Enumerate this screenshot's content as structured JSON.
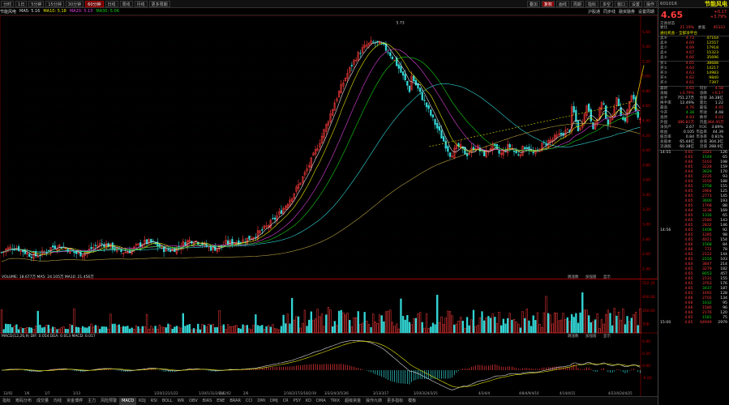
{
  "toolbar": {
    "items": [
      "分时",
      "1日",
      "5分钟",
      "15分钟",
      "30分钟",
      "60分钟",
      "日线",
      "周线",
      "月线",
      "更多周期"
    ],
    "active_index": 5,
    "right_items": [
      "叠加",
      "复权",
      "画线",
      "周期",
      "指标",
      "多空",
      "窗口",
      "设置",
      "操作"
    ],
    "right_active": 1
  },
  "infobar": {
    "name": "节能风电",
    "ma1": "MA5: 5.16",
    "ma2": "MA10: 5.18",
    "ma3": "MA20: 5.13",
    "ma4": "MA30: 5.06",
    "links": [
      "沪股通",
      "同步线",
      "融资融券",
      "设置周期"
    ]
  },
  "main_chart": {
    "peak_label": "5.73",
    "y_ticks": [
      "5.60",
      "5.40",
      "5.20",
      "5.00",
      "4.80",
      "4.60",
      "4.40",
      "4.20",
      "4.00",
      "3.80",
      "3.60",
      "3.40",
      "3.20",
      "3.00",
      "2.80",
      "2.60",
      "2.40"
    ]
  },
  "volume": {
    "header": "VOLUME: 18.677万  MA5: 24.105万  MA10: 21.456万",
    "right_labels": [
      "跳涨数",
      "加强版",
      "显示"
    ],
    "y_ticks": [
      "552.35",
      "400.00",
      "200.00",
      "万手"
    ]
  },
  "macd": {
    "header": "MACD(12,26,9)  DIF: 0.054  DEA: 0.013  MACD: 0.017",
    "right_labels": [
      "跳涨数",
      "加强版",
      "显示"
    ],
    "y_ticks": [
      "0.40",
      "0.20",
      "0.00",
      "-0.20"
    ]
  },
  "x_dates": [
    "12/02",
    "1/6",
    "1/7",
    "1/13",
    "1/20/1/21/1/22",
    "1/30/1/31/2/01/2/02",
    "2/4",
    "2/6",
    "2/16/2/17/2/18/2/19",
    "3/3/3/4/3/5/3/6",
    "3/13/3/17",
    "3/20/3/24/3/25",
    "4/3/4/4",
    "4/8/4/9/4/10",
    "4/14/4/15",
    "4/22/4/24/4/25"
  ],
  "bottom_tabs": [
    "指标",
    "筹码分布",
    "成交量",
    "均线",
    "资金博弈",
    "主力",
    "风险预警",
    "MACD",
    "KDJ",
    "RSI",
    "BOLL",
    "WR",
    "OBV",
    "BIAS",
    "ENE",
    "BRAR",
    "CCI",
    "DMI",
    "DMJ",
    "CR",
    "PSY",
    "KD",
    "DMA",
    "TRIX",
    "超级资金",
    "操作九转",
    "更多指标",
    "模板"
  ],
  "bottom_active": 7,
  "quote": {
    "code": "601016",
    "name": "节能风电",
    "price": "4.65",
    "change": "+0.17",
    "change_pct": "+3.79%",
    "section_title": "交易状态",
    "wei_bi": "21.19%",
    "wei_cha": "45333",
    "wei_bi_label": "委比",
    "wei_cha_label": "委差",
    "news": "通化机会 - 全部净平台",
    "sell": [
      {
        "label": "卖⑨",
        "price": "4.73",
        "vol": "47164"
      },
      {
        "label": "卖⑧",
        "price": "4.69",
        "vol": "12557"
      },
      {
        "label": "卖⑦",
        "price": "4.69",
        "vol": "17918"
      },
      {
        "label": "卖⑥",
        "price": "4.67",
        "vol": "15323"
      },
      {
        "label": "卖⑤",
        "price": "4.66",
        "vol": "35696"
      }
    ],
    "buy": [
      {
        "label": "买①",
        "price": "4.65",
        "vol": "38688"
      },
      {
        "label": "买②",
        "price": "4.64",
        "vol": "14217"
      },
      {
        "label": "买③",
        "price": "4.63",
        "vol": "14983"
      },
      {
        "label": "买④",
        "price": "4.62",
        "vol": "9840"
      },
      {
        "label": "买⑤",
        "price": "4.61",
        "vol": "7397"
      }
    ],
    "stats": [
      {
        "k1": "最新",
        "v1": "4.65",
        "k2": "均价",
        "v2": "4.58"
      },
      {
        "k1": "涨幅",
        "v1": "+3.79%",
        "k2": "涨跌",
        "v2": "+0.17"
      },
      {
        "k1": "总手",
        "v1": "751.27万",
        "k2": "金额",
        "v2": "34.38亿"
      },
      {
        "k1": "换手率",
        "v1": "12.49%",
        "k2": "量比",
        "v2": "1.22"
      },
      {
        "k1": "最高",
        "v1": "4.76",
        "k2": "最低",
        "v2": "4.45"
      },
      {
        "k1": "今开",
        "v1": "4.38",
        "k2": "昨收",
        "v2": "4.48"
      },
      {
        "k1": "涨停",
        "v1": "4.93",
        "k2": "跌停",
        "v2": "4.03"
      },
      {
        "k1": "外盘",
        "v1": "386.81万",
        "k2": "内盘",
        "v2": "364.45万"
      },
      {
        "k1": "净资产",
        "v1": "2.67",
        "k2": "ROE",
        "v2": "3.89%"
      },
      {
        "k1": "收益",
        "v1": "0.105",
        "k2": "市盈率",
        "v2": "44.39"
      },
      {
        "k1": "股息率",
        "v1": "0.84",
        "k2": "市净率",
        "v2": "0.81%"
      },
      {
        "k1": "总股本",
        "v1": "65.44亿",
        "k2": "总值",
        "v2": "304.3亿"
      },
      {
        "k1": "流通股",
        "v1": "60.38亿",
        "k2": "流值",
        "v2": "288.0亿"
      }
    ],
    "ticks": [
      {
        "t": "14:55",
        "p": "4.65",
        "v": "3321",
        "n": "126"
      },
      {
        "t": "",
        "p": "4.65",
        "v": "1549",
        "n": "65"
      },
      {
        "t": "",
        "p": "4.66",
        "v": "5103",
        "n": "198"
      },
      {
        "t": "",
        "p": "4.65",
        "v": "3228",
        "n": "159"
      },
      {
        "t": "",
        "p": "4.64",
        "v": "3629",
        "n": "170"
      },
      {
        "t": "",
        "p": "4.65",
        "v": "2235",
        "n": "93"
      },
      {
        "t": "",
        "p": "4.64",
        "v": "3150",
        "n": "188"
      },
      {
        "t": "",
        "p": "4.65",
        "v": "2758",
        "n": "155"
      },
      {
        "t": "",
        "p": "4.65",
        "v": "2964",
        "n": "125"
      },
      {
        "t": "",
        "p": "4.65",
        "v": "2773",
        "n": "145"
      },
      {
        "t": "",
        "p": "4.65",
        "v": "3600",
        "n": "193"
      },
      {
        "t": "",
        "p": "4.65",
        "v": "1768",
        "n": "88"
      },
      {
        "t": "",
        "p": "4.64",
        "v": "3238",
        "n": "169"
      },
      {
        "t": "",
        "p": "4.65",
        "v": "1316",
        "n": "65"
      },
      {
        "t": "",
        "p": "4.65",
        "v": "2580",
        "n": "143"
      },
      {
        "t": "",
        "p": "4.65",
        "v": "2832",
        "n": "146"
      },
      {
        "t": "14:56",
        "p": "4.65",
        "v": "1408",
        "n": "92"
      },
      {
        "t": "",
        "p": "4.65",
        "v": "1285",
        "n": "98"
      },
      {
        "t": "",
        "p": "4.65",
        "v": "4021",
        "n": "154"
      },
      {
        "t": "",
        "p": "4.66",
        "v": "1568",
        "n": "84"
      },
      {
        "t": "",
        "p": "4.66",
        "v": "772",
        "n": "78"
      },
      {
        "t": "",
        "p": "4.65",
        "v": "2122",
        "n": "144"
      },
      {
        "t": "",
        "p": "4.65",
        "v": "2150",
        "n": "103"
      },
      {
        "t": "",
        "p": "4.64",
        "v": "3847",
        "n": "214"
      },
      {
        "t": "",
        "p": "4.65",
        "v": "3279",
        "n": "182"
      },
      {
        "t": "",
        "p": "4.65",
        "v": "8053",
        "n": "457"
      },
      {
        "t": "",
        "p": "4.65",
        "v": "2131",
        "n": "155"
      },
      {
        "t": "",
        "p": "4.65",
        "v": "3763",
        "n": "176"
      },
      {
        "t": "",
        "p": "4.65",
        "v": "3437",
        "n": "187"
      },
      {
        "t": "",
        "p": "4.65",
        "v": "1692",
        "n": "128"
      },
      {
        "t": "",
        "p": "4.66",
        "v": "2702",
        "n": "134"
      },
      {
        "t": "",
        "p": "4.66",
        "v": "1632",
        "n": "95"
      },
      {
        "t": "",
        "p": "4.66",
        "v": "1580",
        "n": "96"
      },
      {
        "t": "",
        "p": "4.66",
        "v": "2176",
        "n": "120"
      },
      {
        "t": "",
        "p": "4.65",
        "v": "1581",
        "n": "75"
      },
      {
        "t": "15:00",
        "p": "4.65",
        "v": "64949",
        "n": "2979"
      }
    ]
  },
  "colors": {
    "up": "#ff3b3b",
    "down": "#16d416",
    "ma5": "#e6e6e6",
    "ma10": "#e6e600",
    "ma20": "#e040e0",
    "ma30": "#16d416",
    "ma60": "#33d6d6"
  }
}
